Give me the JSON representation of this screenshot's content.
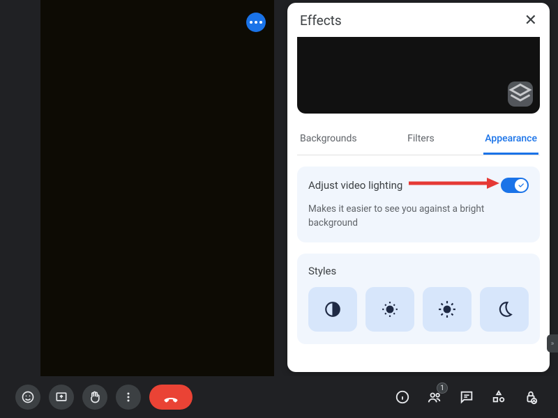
{
  "panel": {
    "title": "Effects",
    "tabs": {
      "backgrounds": "Backgrounds",
      "filters": "Filters",
      "appearance": "Appearance"
    }
  },
  "lighting": {
    "label": "Adjust video lighting",
    "description": "Makes it easier to see you against a bright background",
    "toggle_on": true
  },
  "styles": {
    "title": "Styles",
    "items": [
      "contrast",
      "sun-dim",
      "sun-bright",
      "moon"
    ]
  },
  "toolbar": {
    "people_count": "1"
  }
}
